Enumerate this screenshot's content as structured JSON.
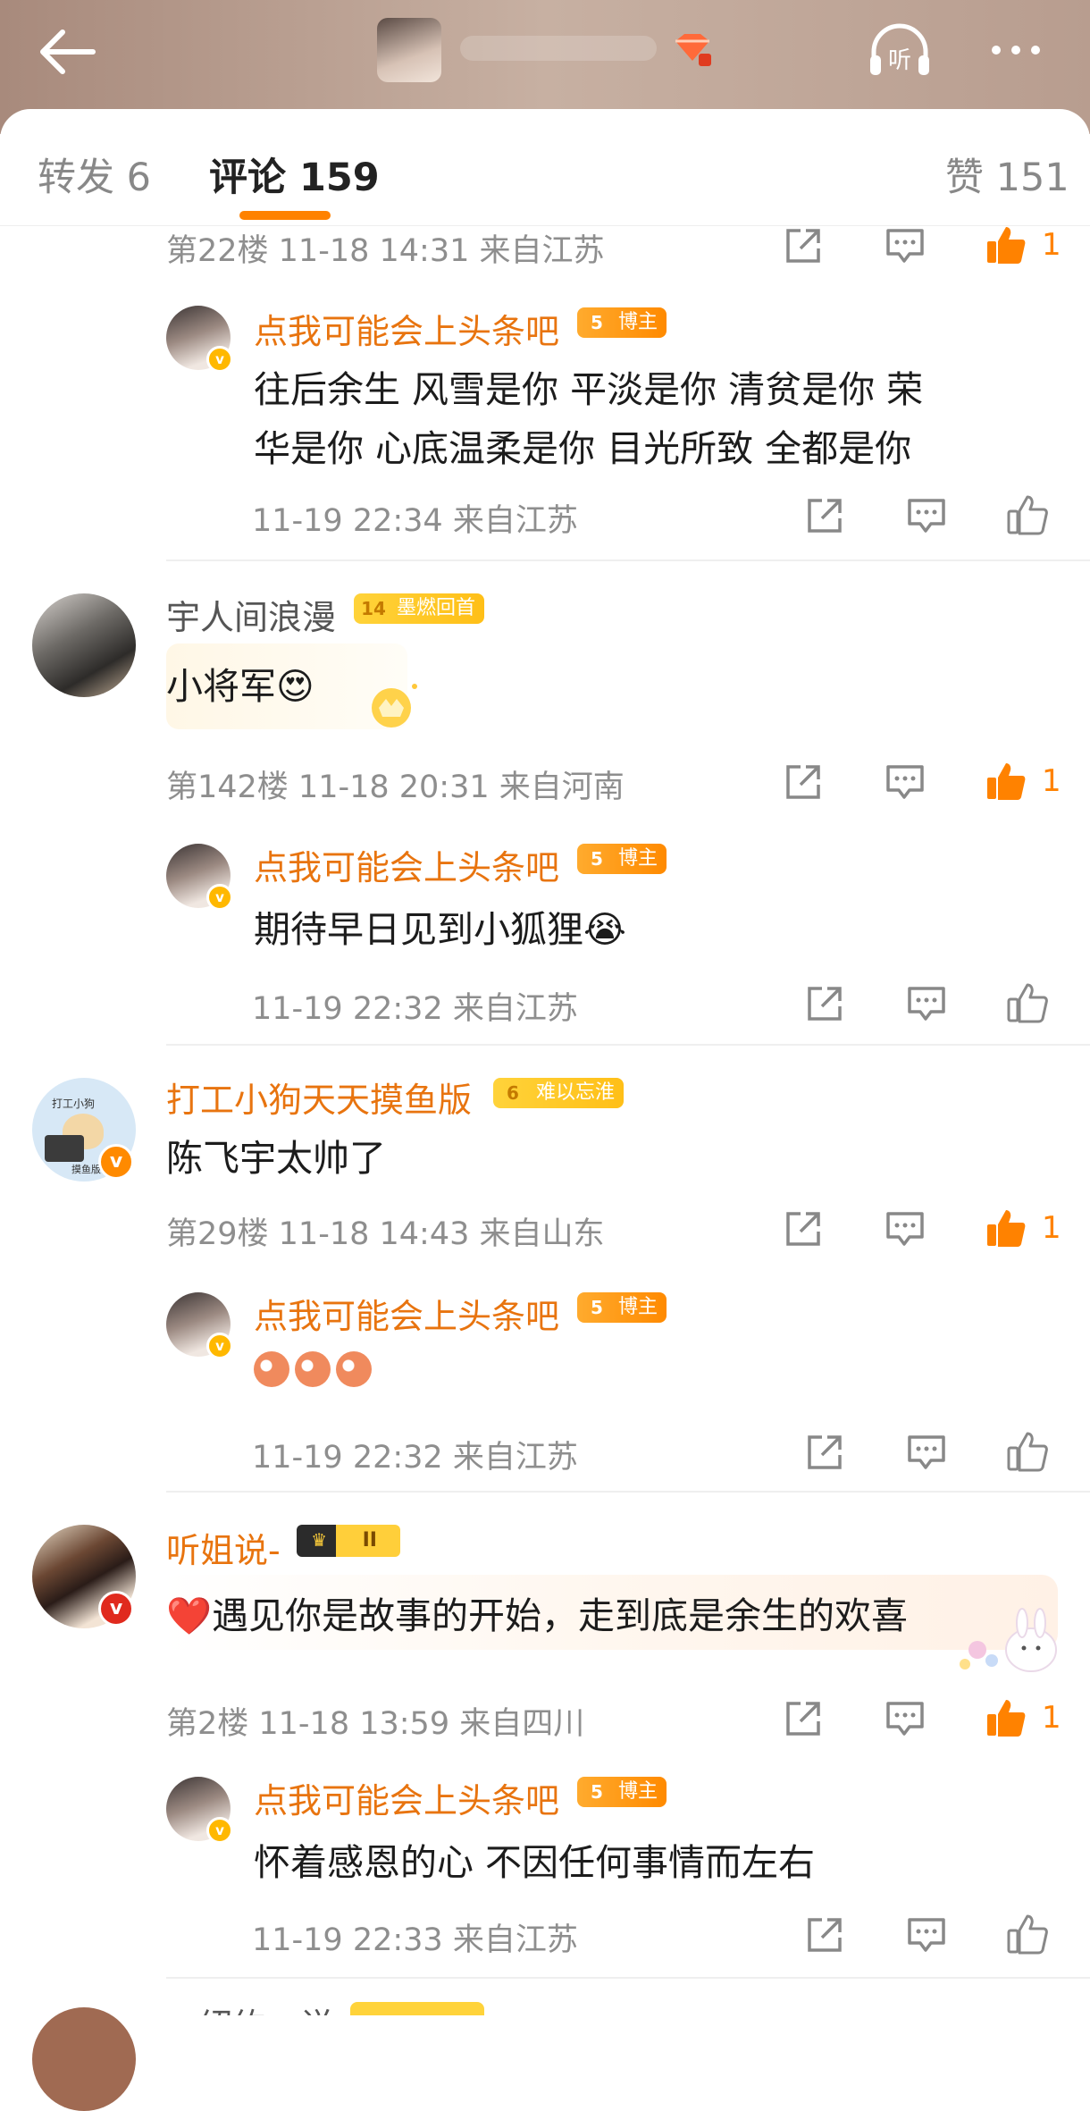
{
  "header": {
    "back_icon": "arrow-left-icon",
    "listen_label": "听",
    "more_icon": "more-dots-icon"
  },
  "tabs": {
    "repost": "转发 6",
    "comments": "评论 159",
    "likes": "赞 151"
  },
  "comments": [
    {
      "meta": "第22楼 11-18 14:31 来自江苏",
      "like_count": "1",
      "reply": {
        "name": "点我可能会上头条吧",
        "badge_level": "5",
        "badge_text": "博主",
        "text_line1": "往后余生  风雪是你  平淡是你  清贫是你  荣",
        "text_line2": "华是你  心底温柔是你  目光所致  全都是你",
        "meta": "11-19 22:34 来自江苏"
      }
    },
    {
      "name": "宇人间浪漫",
      "badge_level": "14",
      "badge_text": "墨燃回首",
      "text": "小将军",
      "emoji": "😍",
      "meta": "第142楼 11-18 20:31 来自河南",
      "like_count": "1",
      "reply": {
        "name": "点我可能会上头条吧",
        "badge_level": "5",
        "badge_text": "博主",
        "text": "期待早日见到小狐狸",
        "emoji": "😭",
        "meta": "11-19 22:32 来自江苏"
      }
    },
    {
      "name": "打工小狗天天摸鱼版",
      "badge_level": "6",
      "badge_text": "难以忘淮",
      "text": "陈飞宇太帅了",
      "avatar_text_top": "打工小狗",
      "avatar_text_bottom": "摸鱼版",
      "meta": "第29楼 11-18 14:43 来自山东",
      "like_count": "1",
      "reply": {
        "name": "点我可能会上头条吧",
        "badge_level": "5",
        "badge_text": "博主",
        "meta": "11-19 22:32 来自江苏"
      }
    },
    {
      "name": "听姐说-",
      "badge_text": "II",
      "text": "遇见你是故事的开始，走到底是余生的欢喜",
      "emoji": "❤️",
      "meta": "第2楼 11-18 13:59 来自四川",
      "like_count": "1",
      "reply": {
        "name": "点我可能会上头条吧",
        "badge_level": "5",
        "badge_text": "博主",
        "text": "怀着感恩的心  不因任何事情而左右",
        "meta": "11-19 22:33 来自江苏"
      }
    },
    {
      "name": "...绍约一说"
    }
  ],
  "colors": {
    "accent": "#ff8200",
    "username_orange": "#e8740f",
    "meta_gray": "#8e8e8e"
  }
}
